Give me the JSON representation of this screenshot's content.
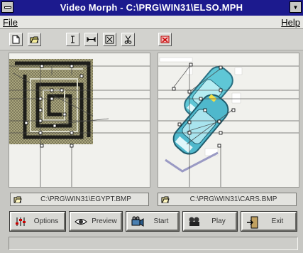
{
  "window": {
    "title": "Video Morph - C:\\PRG\\WIN31\\ELSO.MPH"
  },
  "menu": {
    "file": "File",
    "help": "Help"
  },
  "toolbar": {
    "buttons": [
      {
        "icon": "new-document-icon"
      },
      {
        "icon": "open-folder-icon"
      },
      {
        "icon": "text-cursor-icon"
      },
      {
        "icon": "horizontal-arrows-icon"
      },
      {
        "icon": "expand-icon"
      },
      {
        "icon": "scissors-icon"
      },
      {
        "icon": "delete-icon"
      }
    ]
  },
  "images": {
    "source": {
      "path": "C:\\PRG\\WIN31\\EGYPT.BMP",
      "icon": "open-folder-icon"
    },
    "target": {
      "path": "C:\\PRG\\WIN31\\CARS.BMP",
      "icon": "open-folder-icon"
    }
  },
  "buttons": {
    "options": "Options",
    "preview": "Preview",
    "start": "Start",
    "play": "Play",
    "exit": "Exit"
  },
  "colors": {
    "titlebar": "#1c1a8e",
    "car_body": "#5fc7d6",
    "maze_dark": "#1e1e1a",
    "maze_tan": "#a9a47c"
  },
  "status": {
    "text": ""
  }
}
